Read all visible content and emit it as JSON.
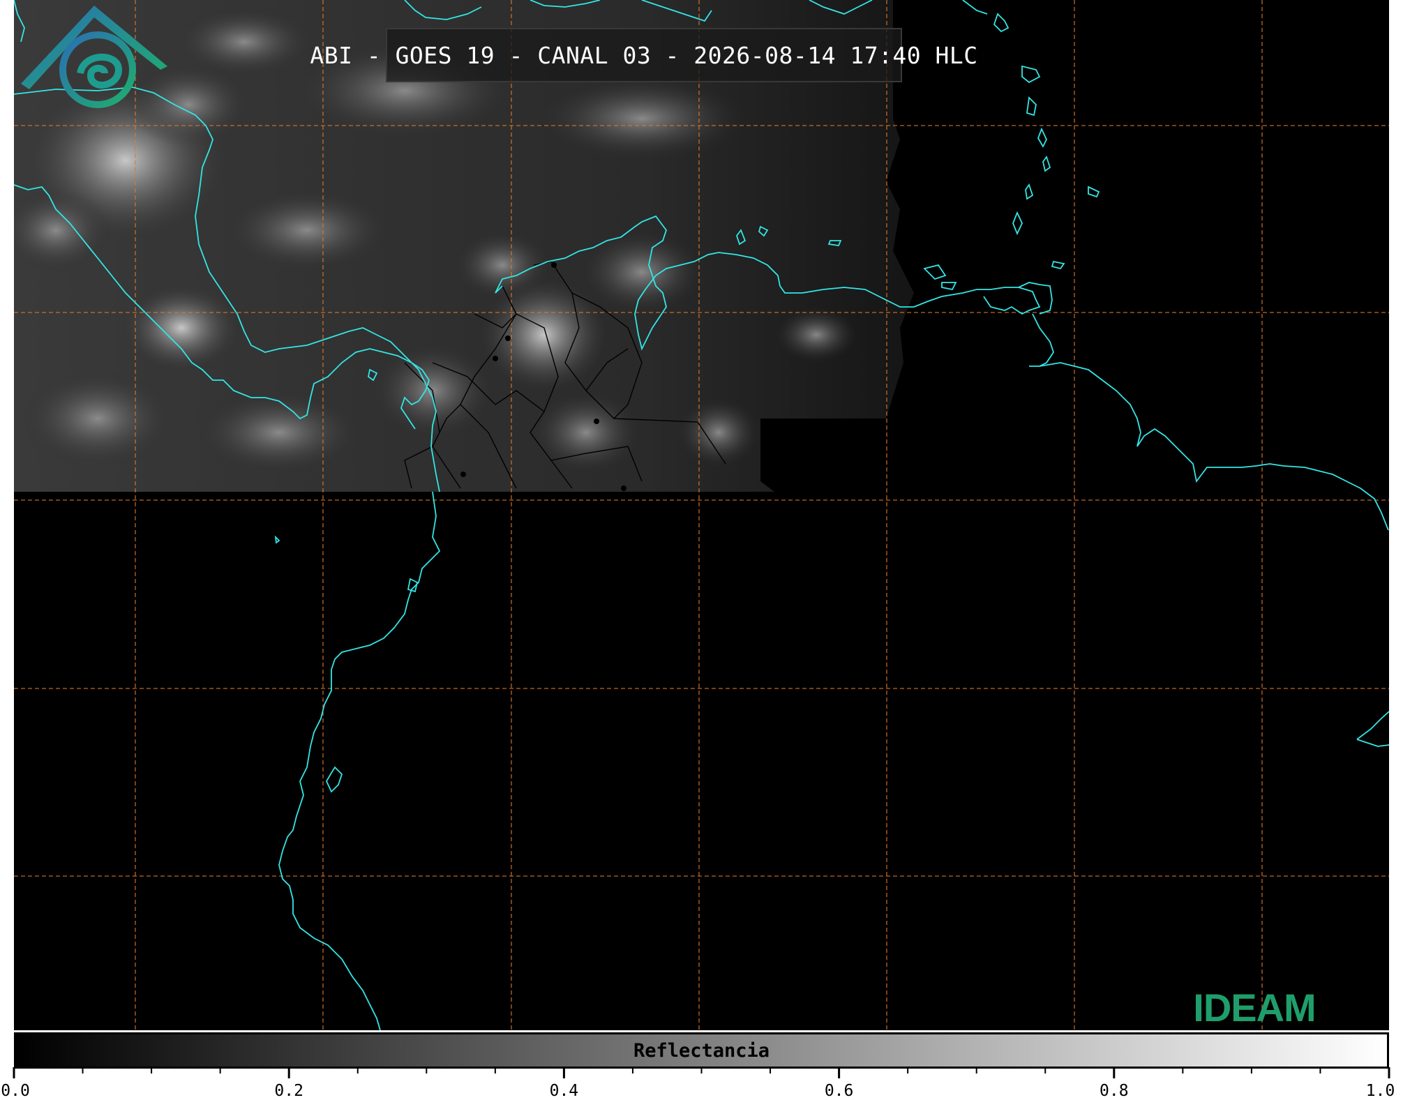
{
  "title": "ABI - GOES 19 - CANAL 03 - 2026-08-14 17:40 HLC",
  "colorbar": {
    "label": "Reflectancia",
    "min": 0.0,
    "max": 1.0,
    "tick_labels": [
      "0.0",
      "0.2",
      "0.4",
      "0.6",
      "0.8",
      "1.0"
    ],
    "colors": [
      "#000000",
      "#ffffff"
    ]
  },
  "logo": {
    "text": "IDEAM",
    "color": "#1f9e6b"
  },
  "map": {
    "background": "#000000",
    "coastline_color": "#33e6e6",
    "border_color": "#000000",
    "gridline_color": "#e0782a"
  }
}
